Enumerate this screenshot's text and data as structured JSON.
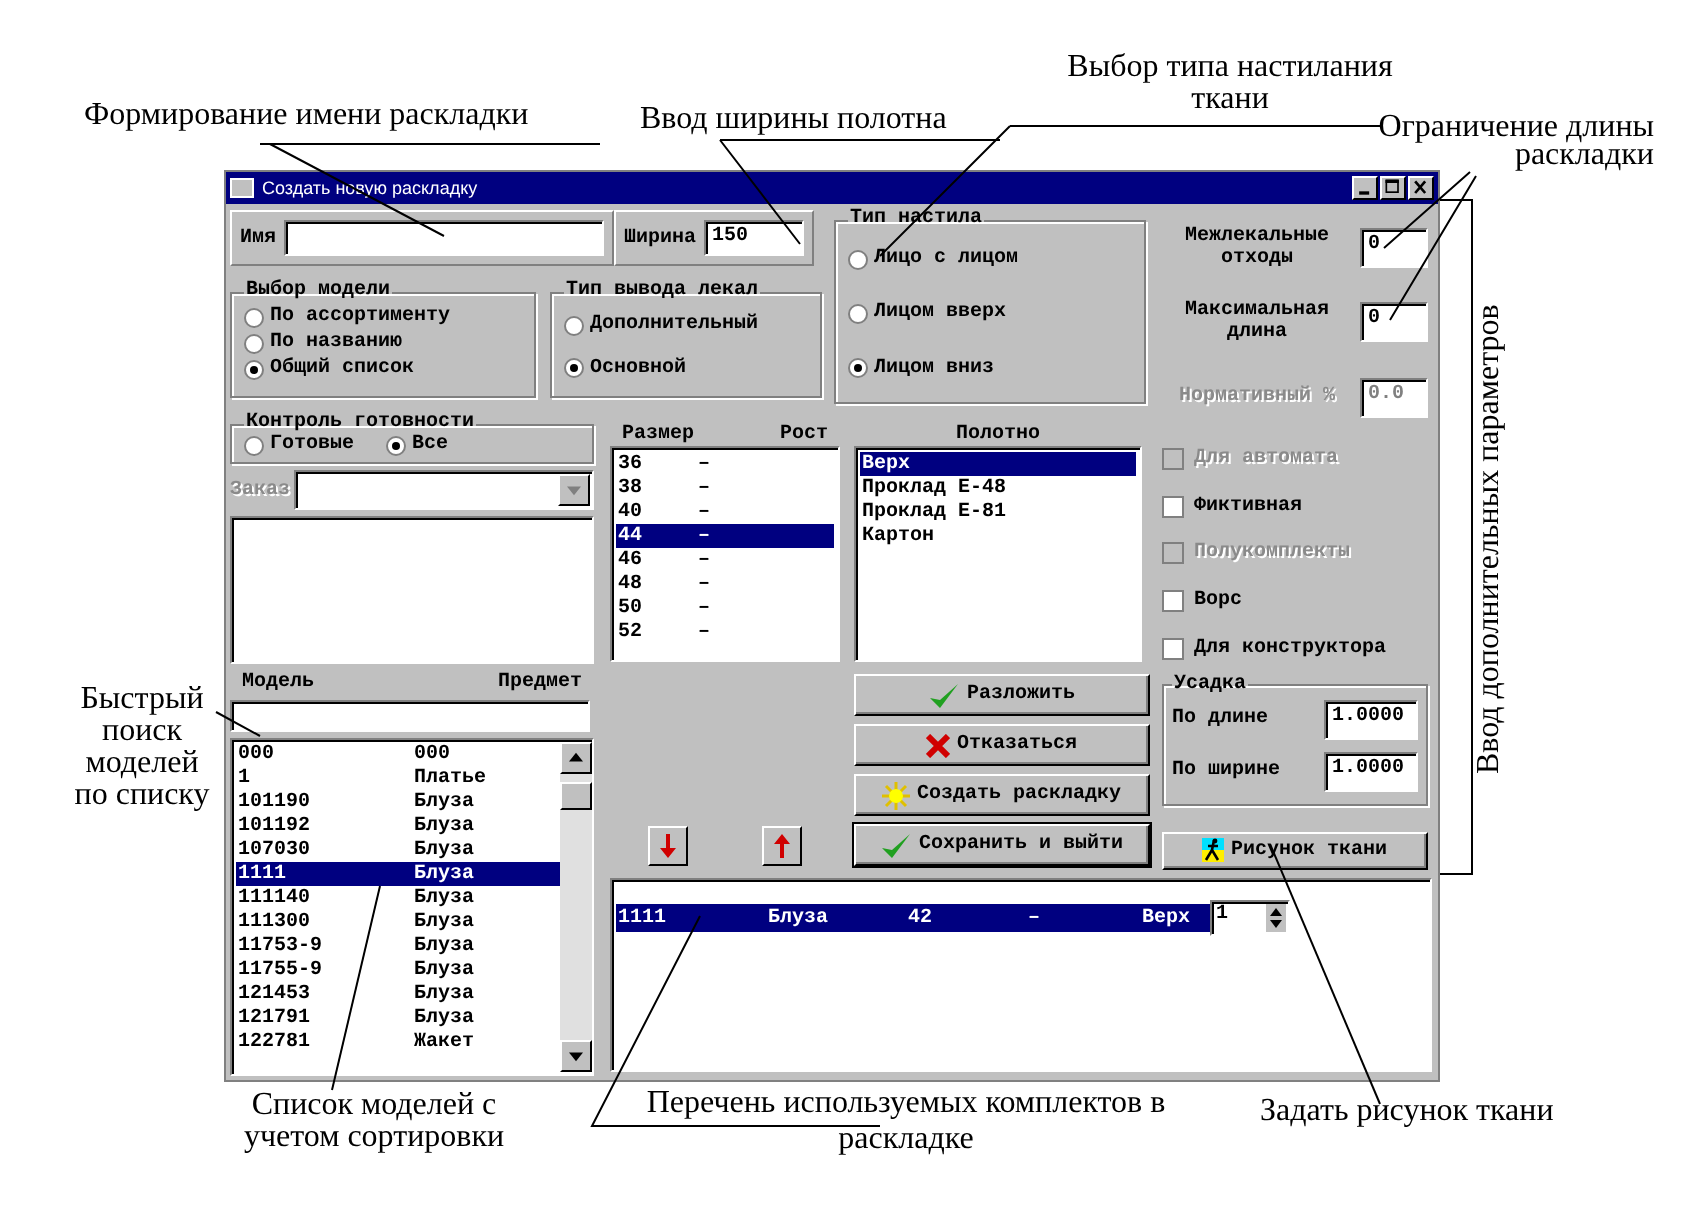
{
  "annotations": [
    {
      "text": "Формирование имени раскладки"
    },
    {
      "text": "Ввод ширины полотна"
    },
    {
      "text": "Выбор типа настилания ткани"
    },
    {
      "text": "Ограничение длины раскладки"
    },
    {
      "text": "Ввод дополнительных параметров"
    },
    {
      "text": "Быстрый поиск моделей по списку"
    },
    {
      "text": "Список моделей с учетом сортировки"
    },
    {
      "text": "Перечень используемых комплектов в раскладке"
    },
    {
      "text": "Задать рисунок ткани"
    }
  ],
  "window": {
    "title": "Создать новую раскладку"
  },
  "name_field": {
    "label": "Имя"
  },
  "width_field": {
    "label": "Ширина",
    "value": "150"
  },
  "model_choice": {
    "title": "Выбор модели",
    "options": [
      {
        "label": "По ассортименту",
        "selected": false
      },
      {
        "label": "По названию",
        "selected": false
      },
      {
        "label": "Общий список",
        "selected": true
      }
    ]
  },
  "output_type": {
    "title": "Тип вывода лекал",
    "options": [
      {
        "label": "Дополнительный",
        "selected": false
      },
      {
        "label": "Основной",
        "selected": true
      }
    ]
  },
  "spread_type": {
    "title": "Тип настила",
    "options": [
      {
        "label": "Лицо с лицом",
        "selected": false
      },
      {
        "label": "Лицом вверх",
        "selected": false
      },
      {
        "label": "Лицом вниз",
        "selected": true
      }
    ]
  },
  "readiness": {
    "title": "Контроль готовности",
    "options": [
      {
        "label": "Готовые",
        "selected": false
      },
      {
        "label": "Все",
        "selected": true
      }
    ]
  },
  "order": {
    "label": "Заказ",
    "disabled": true
  },
  "models": {
    "columns": [
      "Модель",
      "Предмет"
    ],
    "rows": [
      {
        "model": "000",
        "item": "000",
        "selected": false
      },
      {
        "model": "1",
        "item": "Платье",
        "selected": false
      },
      {
        "model": "101190",
        "item": "Блуза",
        "selected": false
      },
      {
        "model": "101192",
        "item": "Блуза",
        "selected": false
      },
      {
        "model": "107030",
        "item": "Блуза",
        "selected": false
      },
      {
        "model": "1111",
        "item": "Блуза",
        "selected": true
      },
      {
        "model": "111140",
        "item": "Блуза",
        "selected": false
      },
      {
        "model": "111300",
        "item": "Блуза",
        "selected": false
      },
      {
        "model": "11753-9",
        "item": "Блуза",
        "selected": false
      },
      {
        "model": "11755-9",
        "item": "Блуза",
        "selected": false
      },
      {
        "model": "121453",
        "item": "Блуза",
        "selected": false
      },
      {
        "model": "121791",
        "item": "Блуза",
        "selected": false
      },
      {
        "model": "122781",
        "item": "Жакет",
        "selected": false
      }
    ]
  },
  "sizes": {
    "columns": [
      "Размер",
      "Рост"
    ],
    "rows": [
      {
        "size": "36",
        "height": "–",
        "selected": false
      },
      {
        "size": "38",
        "height": "–",
        "selected": false
      },
      {
        "size": "40",
        "height": "–",
        "selected": false
      },
      {
        "size": "44",
        "height": "–",
        "selected": true
      },
      {
        "size": "46",
        "height": "–",
        "selected": false
      },
      {
        "size": "48",
        "height": "–",
        "selected": false
      },
      {
        "size": "50",
        "height": "–",
        "selected": false
      },
      {
        "size": "52",
        "height": "–",
        "selected": false
      }
    ]
  },
  "fabric": {
    "title": "Полотно",
    "items": [
      {
        "label": "Верх",
        "selected": true
      },
      {
        "label": "Проклад Е-48",
        "selected": false
      },
      {
        "label": "Проклад Е-81",
        "selected": false
      },
      {
        "label": "Картон",
        "selected": false
      }
    ]
  },
  "actions": [
    {
      "label": "Разложить",
      "kind": "check",
      "default": false
    },
    {
      "label": "Отказаться",
      "kind": "cross",
      "default": false
    },
    {
      "label": "Создать раскладку",
      "kind": "sun",
      "default": false
    },
    {
      "label": "Сохранить и выйти",
      "kind": "check",
      "default": true
    }
  ],
  "params": {
    "fields": [
      {
        "label": "Межлекальные отходы",
        "value": "0",
        "disabled": false
      },
      {
        "label": "Максимальная длина",
        "value": "0",
        "disabled": false
      },
      {
        "label": "Нормативный %",
        "value": "0.0",
        "disabled": true
      }
    ],
    "checkboxes": [
      {
        "label": "Для автомата",
        "checked": false,
        "disabled": true
      },
      {
        "label": "Фиктивная",
        "checked": false,
        "disabled": false
      },
      {
        "label": "Полукомплекты",
        "checked": false,
        "disabled": true
      },
      {
        "label": "Ворс",
        "checked": false,
        "disabled": false
      },
      {
        "label": "Для конструктора",
        "checked": false,
        "disabled": false
      }
    ]
  },
  "shrinkage": {
    "title": "Усадка",
    "fields": [
      {
        "label": "По длине",
        "value": "1.0000"
      },
      {
        "label": "По ширине",
        "value": "1.0000"
      }
    ]
  },
  "pattern_button": {
    "label": "Рисунок ткани"
  },
  "layout_items": {
    "rows": [
      {
        "cells": [
          "1111",
          "Блуза",
          "42",
          "–",
          "Верх"
        ],
        "count": "1",
        "selected": true
      }
    ]
  }
}
